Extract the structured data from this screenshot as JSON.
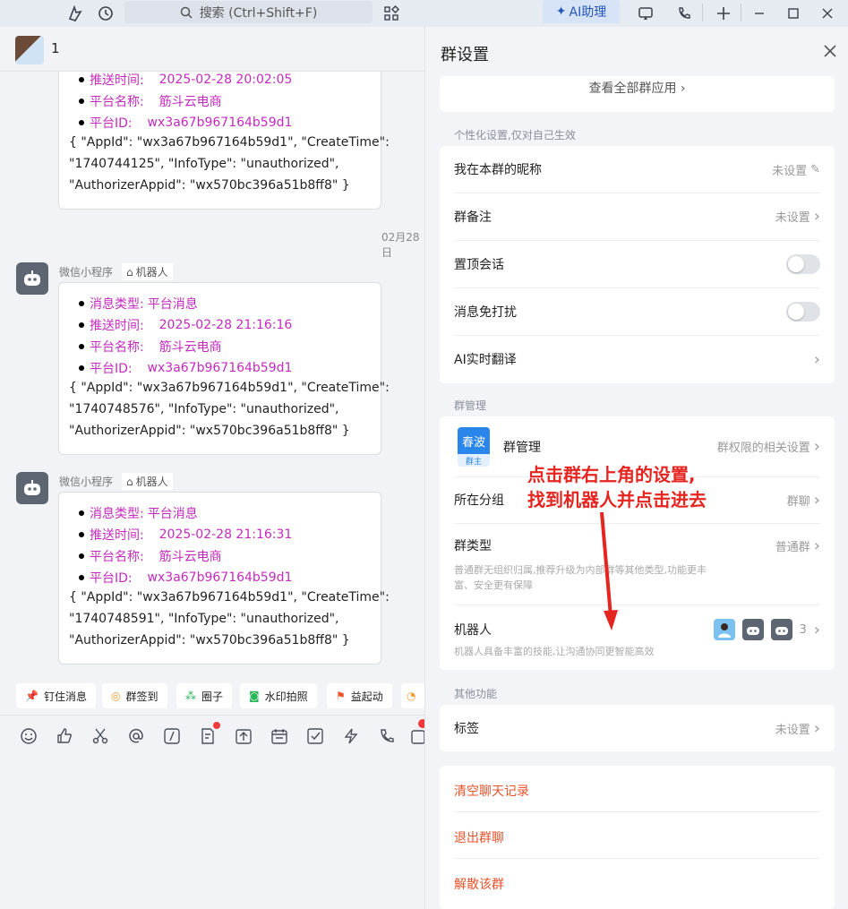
{
  "topbar": {
    "search_placeholder": "搜索 (Ctrl+Shift+F)",
    "ai_label": "AI助理"
  },
  "chat": {
    "title": "1",
    "date_separator": "02月28日",
    "sender_name": "微信小程序",
    "robot_tag": "机器人",
    "messages": [
      {
        "bullets": [
          {
            "label": "推送时间:",
            "value": "2025-02-28 20:02:05"
          },
          {
            "label": "平台名称:",
            "value": "筋斗云电商"
          },
          {
            "label": "平台ID:",
            "value": "wx3a67b967164b59d1"
          }
        ],
        "json_lines": [
          "{ \"AppId\": \"wx3a67b967164b59d1\", \"CreateTime\":",
          "\"1740744125\", \"InfoType\": \"unauthorized\",",
          "\"AuthorizerAppid\": \"wx570bc396a51b8ff8\" }"
        ]
      },
      {
        "bullets": [
          {
            "label": "消息类型:",
            "value": "平台消息"
          },
          {
            "label": "推送时间:",
            "value": "2025-02-28 21:16:16"
          },
          {
            "label": "平台名称:",
            "value": "筋斗云电商"
          },
          {
            "label": "平台ID:",
            "value": "wx3a67b967164b59d1"
          }
        ],
        "json_lines": [
          "{ \"AppId\": \"wx3a67b967164b59d1\", \"CreateTime\":",
          "\"1740748576\", \"InfoType\": \"unauthorized\",",
          "\"AuthorizerAppid\": \"wx570bc396a51b8ff8\" }"
        ]
      },
      {
        "bullets": [
          {
            "label": "消息类型:",
            "value": "平台消息"
          },
          {
            "label": "推送时间:",
            "value": "2025-02-28 21:16:31"
          },
          {
            "label": "平台名称:",
            "value": "筋斗云电商"
          },
          {
            "label": "平台ID:",
            "value": "wx3a67b967164b59d1"
          }
        ],
        "json_lines": [
          "{ \"AppId\": \"wx3a67b967164b59d1\", \"CreateTime\":",
          "\"1740748591\", \"InfoType\": \"unauthorized\",",
          "\"AuthorizerAppid\": \"wx570bc396a51b8ff8\" }"
        ]
      }
    ],
    "quick_actions": [
      "钉住消息",
      "群签到",
      "圈子",
      "水印拍照",
      "益起动"
    ]
  },
  "panel": {
    "title": "群设置",
    "view_all_apps": "查看全部群应用",
    "personal_section": "个性化设置,仅对自己生效",
    "nickname_label": "我在本群的昵称",
    "nickname_value": "未设置",
    "remark_label": "群备注",
    "remark_value": "未设置",
    "pin_label": "置顶会话",
    "pin_on": false,
    "mute_label": "消息免打扰",
    "mute_on": false,
    "translate_label": "AI实时翻译",
    "manage_section": "群管理",
    "badge_name": "春波",
    "badge_role": "群主",
    "group_manage_label": "群管理",
    "group_manage_value": "群权限的相关设置",
    "group_folder_label": "所在分组",
    "group_folder_value": "群聊",
    "group_type_label": "群类型",
    "group_type_value": "普通群",
    "group_type_desc_1": "普通群无组织归属,推荐升级为内部群等其他类型,功能更丰",
    "group_type_desc_2": "富、安全更有保障",
    "robot_label": "机器人",
    "robot_desc": "机器人具备丰富的技能,让沟通协同更智能高效",
    "robot_count": "3",
    "other_section": "其他功能",
    "tag_label": "标签",
    "tag_value": "未设置",
    "clear_history": "清空聊天记录",
    "leave_group": "退出群聊",
    "dismiss_group": "解散该群"
  },
  "annotation": {
    "line1": "点击群右上角的设置,",
    "line2": "找到机器人并点击进去"
  },
  "colors": {
    "accent": "#2356b8",
    "bullet_text": "#c42bbd",
    "danger": "#e8542c",
    "annotation": "#e52520"
  }
}
